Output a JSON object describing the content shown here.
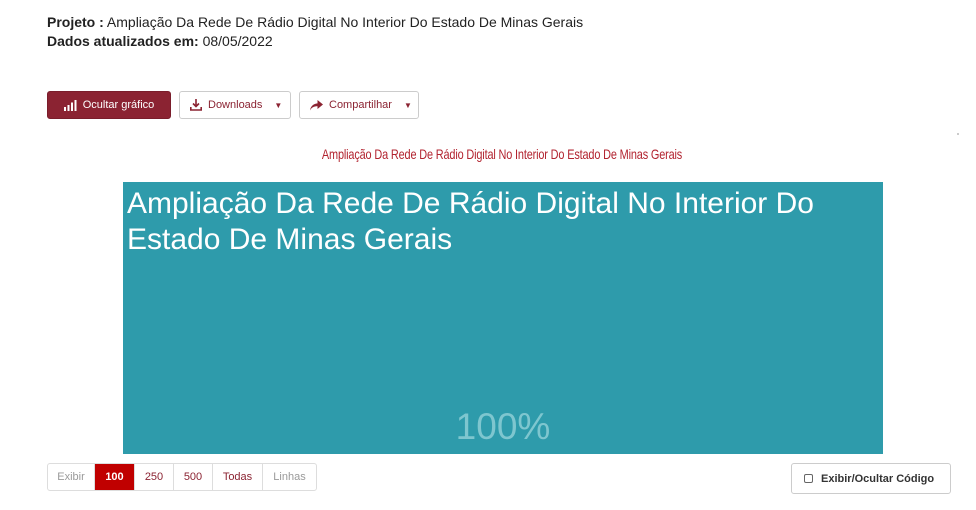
{
  "info": {
    "project_label": "Projeto :",
    "project_value": "Ampliação Da Rede De Rádio Digital No Interior Do Estado De Minas Gerais",
    "updated_label": "Dados atualizados em:",
    "updated_value": "08/05/2022"
  },
  "toolbar": {
    "hide_chart_label": "Ocultar gráfico",
    "downloads_label": "Downloads",
    "share_label": "Compartilhar"
  },
  "chart_data": {
    "type": "treemap",
    "title": "Ampliação Da Rede De Rádio Digital No Interior Do Estado De Minas Gerais",
    "tiles": [
      {
        "label": "Ampliação Da Rede De Rádio Digital No Interior Do Estado De Minas Gerais",
        "value_label": "100%",
        "share": 100,
        "color": "#2e9bab"
      }
    ]
  },
  "pager": {
    "show_label": "Exibir",
    "options": [
      "100",
      "250",
      "500",
      "Todas",
      "Linhas"
    ],
    "selected": "100"
  },
  "code_toggle": {
    "label": "Exibir/Ocultar Código"
  },
  "colors": {
    "brand": "#8b2332",
    "accent_red": "#c00000",
    "tile": "#2e9bab"
  }
}
